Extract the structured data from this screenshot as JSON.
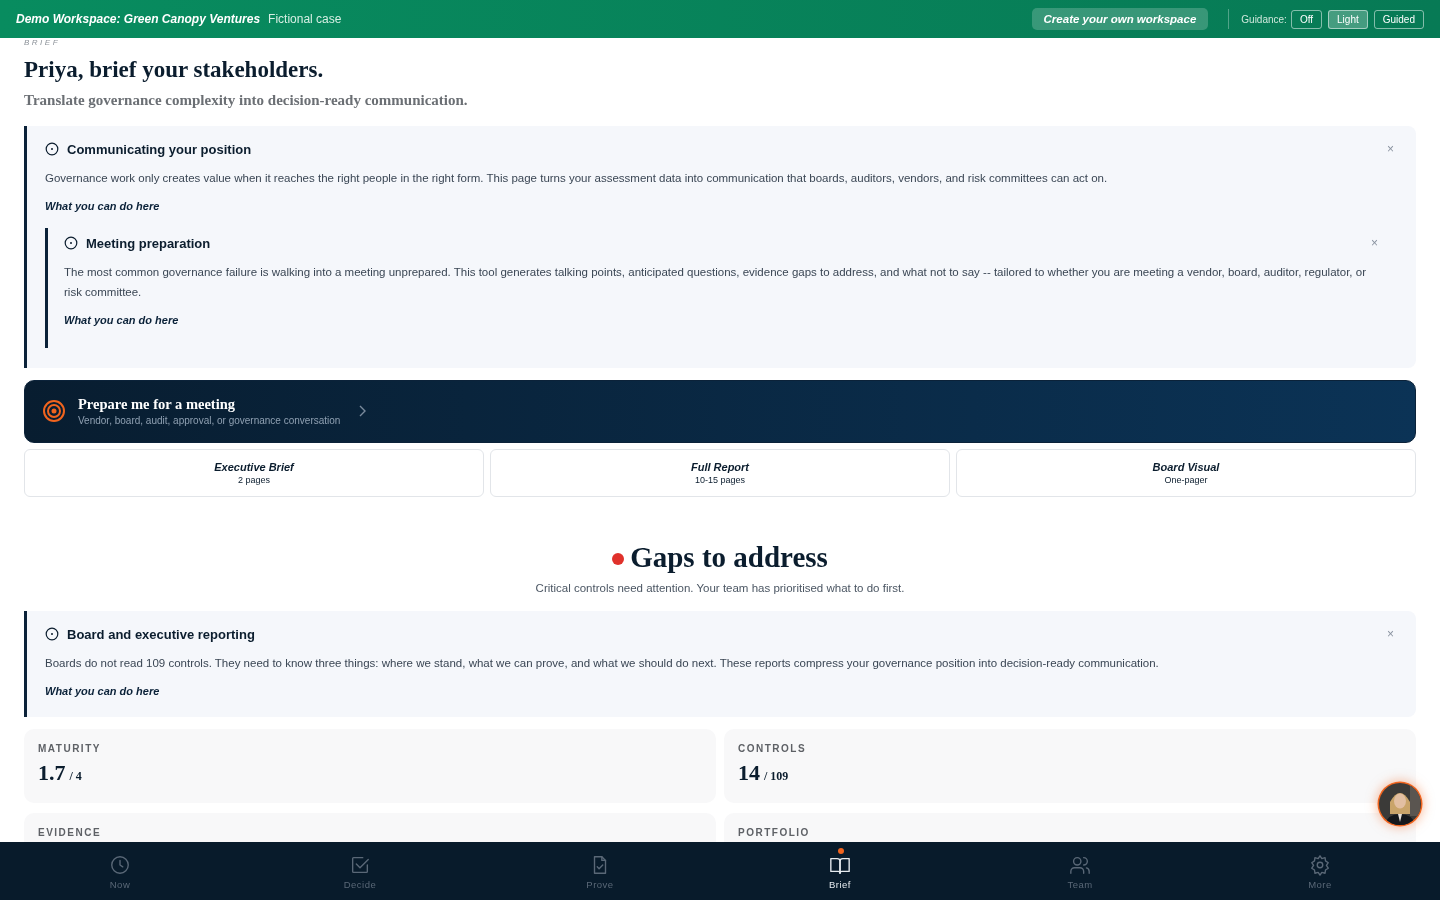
{
  "header": {
    "workspace": "Demo Workspace: Green Canopy Ventures",
    "tag": "Fictional case",
    "cta": "Create your own workspace",
    "guidance_label": "Guidance:",
    "guidance_options": [
      {
        "label": "Off",
        "selected": false
      },
      {
        "label": "Light",
        "selected": true
      },
      {
        "label": "Guided",
        "selected": false
      }
    ]
  },
  "page": {
    "eyebrow": "BRIEF",
    "title": "Priya, brief your stakeholders.",
    "subtitle": "Translate governance complexity into decision-ready communication."
  },
  "info_panel": {
    "title": "Communicating your position",
    "body": "Governance work only creates value when it reaches the right people in the right form. This page turns your assessment data into communication that boards, auditors, vendors, and risk committees can act on.",
    "link": "What you can do here",
    "close": "×",
    "nested": {
      "title": "Meeting preparation",
      "body": "The most common governance failure is walking into a meeting unprepared. This tool generates talking points, anticipated questions, evidence gaps to address, and what not to say -- tailored to whether you are meeting a vendor, board, auditor, regulator, or risk committee.",
      "link": "What you can do here",
      "close": "×"
    }
  },
  "meeting_cta": {
    "title": "Prepare me for a meeting",
    "subtitle": "Vendor, board, audit, approval, or governance conversation"
  },
  "reports": [
    {
      "title": "Executive Brief",
      "detail": "2 pages"
    },
    {
      "title": "Full Report",
      "detail": "10-15 pages"
    },
    {
      "title": "Board Visual",
      "detail": "One-pager"
    }
  ],
  "gaps": {
    "title": "Gaps to address",
    "subtitle": "Critical controls need attention. Your team has prioritised what to do first.",
    "color": "#e0312b"
  },
  "reporting_panel": {
    "title": "Board and executive reporting",
    "body": "Boards do not read 109 controls. They need to know three things: where we stand, what we can prove, and what we should do next. These reports compress your governance position into decision-ready communication.",
    "link": "What you can do here",
    "close": "×"
  },
  "stats": [
    {
      "label": "MATURITY",
      "value": "1.7",
      "total": "/ 4"
    },
    {
      "label": "CONTROLS",
      "value": "14",
      "total": "/ 109"
    },
    {
      "label": "EVIDENCE"
    },
    {
      "label": "PORTFOLIO"
    }
  ],
  "nav": [
    {
      "label": "Now",
      "selected": false,
      "notification": false
    },
    {
      "label": "Decide",
      "selected": false,
      "notification": false
    },
    {
      "label": "Prove",
      "selected": false,
      "notification": false
    },
    {
      "label": "Brief",
      "selected": true,
      "notification": true
    },
    {
      "label": "Team",
      "selected": false,
      "notification": false
    },
    {
      "label": "More",
      "selected": false,
      "notification": false
    }
  ]
}
